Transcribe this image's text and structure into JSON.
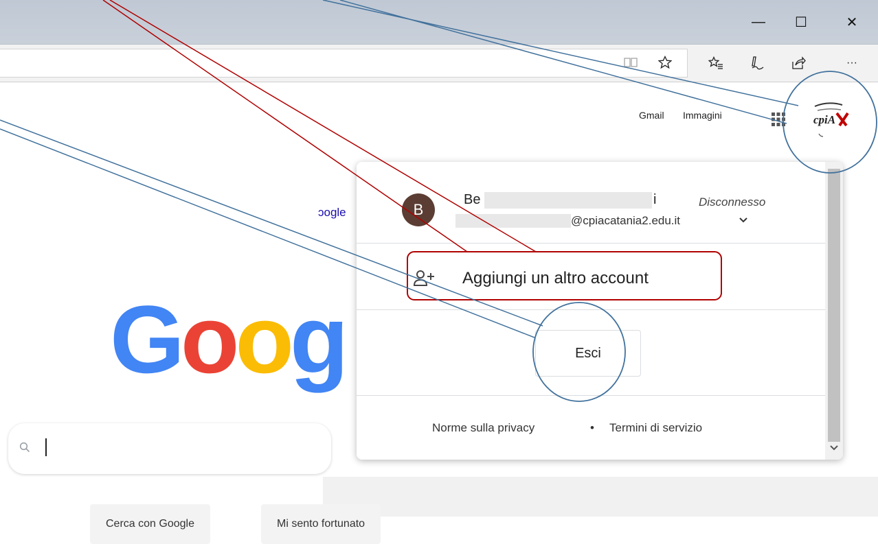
{
  "window": {
    "minimize_glyph": "—",
    "maximize_glyph": "☐",
    "close_glyph": "✕"
  },
  "toolbar": {
    "more_glyph": "···"
  },
  "google_header": {
    "gmail": "Gmail",
    "images": "Immagini",
    "avatar_logo_text": "cpiA"
  },
  "partial_link": "ɔogle",
  "logo": {
    "text": "Goog",
    "colors": [
      "#4285F4",
      "#EA4335",
      "#FBBC05",
      "#4285F4"
    ]
  },
  "search": {
    "value": "",
    "icon": "search-icon"
  },
  "buttons": {
    "search": "Cerca con Google",
    "lucky": "Mi sento fortunato"
  },
  "account_popup": {
    "avatar_initial": "B",
    "name_prefix": "Be",
    "name_suffix": "i",
    "status": "Disconnesso",
    "email_suffix": "@cpiacatania2.edu.it",
    "add_account": "Aggiungi un altro account",
    "sign_out": "Esci",
    "privacy": "Norme sulla privacy",
    "separator": "•",
    "terms": "Termini di servizio"
  },
  "colors": {
    "annotation_red": "#b00000",
    "annotation_blue": "#41719c",
    "avatar_bg": "#5b3d33"
  }
}
